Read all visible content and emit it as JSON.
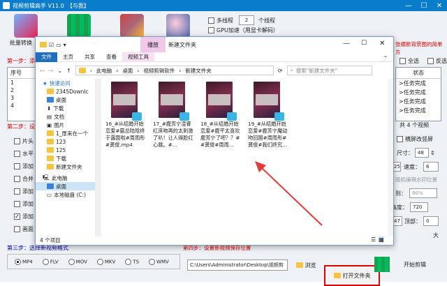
{
  "app": {
    "title": "视频剪辑高手 V11.0",
    "tag": "【与我】"
  },
  "toolbar": {
    "batch_label": "批量转换",
    "multithread_label": "多线程",
    "thread_count": "2",
    "thread_unit": "个线程",
    "gpu_label": "GPU加速（用显卡解码）",
    "right_hint": "张横新背景图的简单方"
  },
  "step1": {
    "label": "第一步：添",
    "col_seq": "序号",
    "rows": [
      "1",
      "2",
      "3",
      "4"
    ],
    "col_status": "状态",
    "statuses": [
      "任务完成",
      "任务完成",
      "任务完成",
      "任务完成"
    ],
    "select_all": "全选",
    "invert": "反选"
  },
  "step2": {
    "label": "第二步：设",
    "options": [
      "片头",
      "水平",
      "添加",
      "合并",
      "添加",
      "添加",
      "添加",
      "画面"
    ],
    "video_count": "共 4 个视频",
    "horizontal_label": "横屏改竖屏",
    "size_label": "尺寸：",
    "size_value": "48",
    "speed_value": "25",
    "speed_label": "速度：",
    "speed_select": "6",
    "rand_label": "随机编辑水印位置",
    "to_label": "到：",
    "to_value": "80%",
    "height_label": "高度：",
    "height_value": "720",
    "top_value": "47",
    "top_label": "顶部：",
    "top_value2": "0",
    "large_label": "大"
  },
  "step3": {
    "label": "第三步：选择新视频格式",
    "formats": [
      "MP4",
      "FLV",
      "MOV",
      "MKV",
      "TS",
      "WMV"
    ],
    "save_label": "第四步：设置新视频保存位置",
    "path": "C:\\Users\\Administrator\\Desktop\\视频剪",
    "browse": "浏览",
    "open_folder": "打开文件夹",
    "start": "开始剪辑"
  },
  "explorer": {
    "title": "新建文件夹",
    "play_tab": "播放",
    "ribbon_tabs": [
      "文件",
      "主页",
      "共享",
      "查看",
      "视频工具"
    ],
    "breadcrumb": [
      "此电脑",
      "桌面",
      "视频剪辑软件",
      "新建文件夹"
    ],
    "search_placeholder": "搜索\"新建文件夹\"",
    "nav_items": [
      "快速访问",
      "2345Downlc",
      "桌面",
      "下载",
      "文档",
      "图片",
      "1_厚来在一个",
      "123",
      "125",
      "下载",
      "新建文件夹",
      "此电脑",
      "桌面",
      "本地磁盘 (C:)"
    ],
    "files": [
      "16_#从结婚开始恋爱#霸总陆晗终于露面啦#周雨彤#龚俊.mp4",
      "17_#鹿芳宁凌睿红床吻再的太刺激了叭！让人得脸红心跳。#...",
      "18_#从结婚开始恋爱#鹿芊太喜欢鹿芳宁了吧？？##龚俊#周雨...",
      "19_#从结婚开始恋爱#鹿芳宁魔动吻回国#周雨彤#龚俊#我们终究..."
    ],
    "status": "4 个项目"
  },
  "colors": {
    "titlebar": "#0a7ccc",
    "accent_red": "#d00000",
    "play_tab": "#f0c8e8",
    "file_tab": "#1f6fbf"
  }
}
